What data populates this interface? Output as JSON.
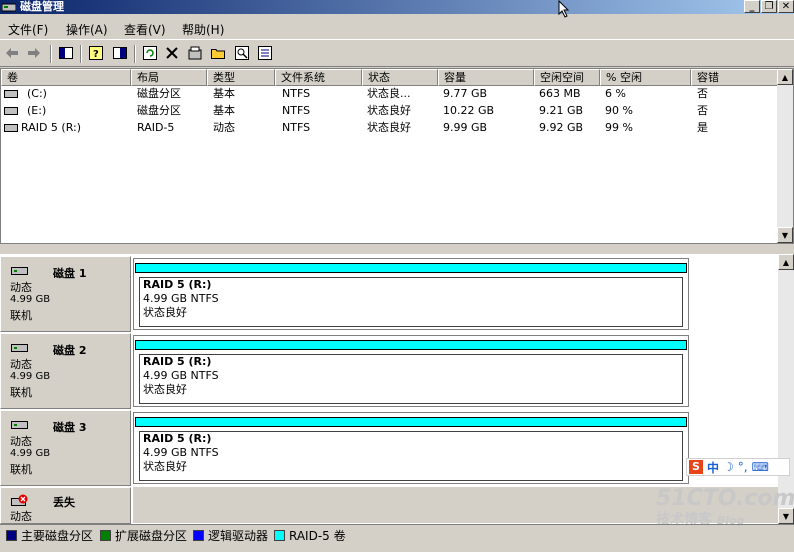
{
  "window": {
    "title": "磁盘管理"
  },
  "menu": [
    "文件(F)",
    "操作(A)",
    "查看(V)",
    "帮助(H)"
  ],
  "columns": [
    "卷",
    "布局",
    "类型",
    "文件系统",
    "状态",
    "容量",
    "空闲空间",
    "% 空闲",
    "容错"
  ],
  "volumes": [
    {
      "name": "(C:)",
      "layout": "磁盘分区",
      "type": "基本",
      "fs": "NTFS",
      "status": "状态良...",
      "capacity": "9.77 GB",
      "free": "663 MB",
      "pct": "6 %",
      "ft": "否"
    },
    {
      "name": "(E:)",
      "layout": "磁盘分区",
      "type": "基本",
      "fs": "NTFS",
      "status": "状态良好",
      "capacity": "10.22 GB",
      "free": "9.21 GB",
      "pct": "90 %",
      "ft": "否"
    },
    {
      "name": "RAID 5 (R:)",
      "layout": "RAID-5",
      "type": "动态",
      "fs": "NTFS",
      "status": "状态良好",
      "capacity": "9.99 GB",
      "free": "9.92 GB",
      "pct": "99 %",
      "ft": "是"
    }
  ],
  "disks": [
    {
      "name": "磁盘 1",
      "type": "动态",
      "size": "4.99 GB",
      "state": "联机",
      "vol_name": "RAID 5  (R:)",
      "vol_size": "4.99 GB NTFS",
      "vol_status": "状态良好"
    },
    {
      "name": "磁盘 2",
      "type": "动态",
      "size": "4.99 GB",
      "state": "联机",
      "vol_name": "RAID 5  (R:)",
      "vol_size": "4.99 GB NTFS",
      "vol_status": "状态良好"
    },
    {
      "name": "磁盘 3",
      "type": "动态",
      "size": "4.99 GB",
      "state": "联机",
      "vol_name": "RAID 5  (R:)",
      "vol_size": "4.99 GB NTFS",
      "vol_status": "状态良好"
    }
  ],
  "missing_disk": {
    "name": "丢失",
    "type": "动态"
  },
  "legend": [
    {
      "label": "主要磁盘分区",
      "color": "#000080"
    },
    {
      "label": "扩展磁盘分区",
      "color": "#008000"
    },
    {
      "label": "逻辑驱动器",
      "color": "#0000ff"
    },
    {
      "label": "RAID-5 卷",
      "color": "#00ffff"
    }
  ],
  "ime": {
    "zh": "中"
  },
  "watermark": {
    "line1": "51CTO.com",
    "line2": "技术博客",
    "line3": "Blog"
  }
}
